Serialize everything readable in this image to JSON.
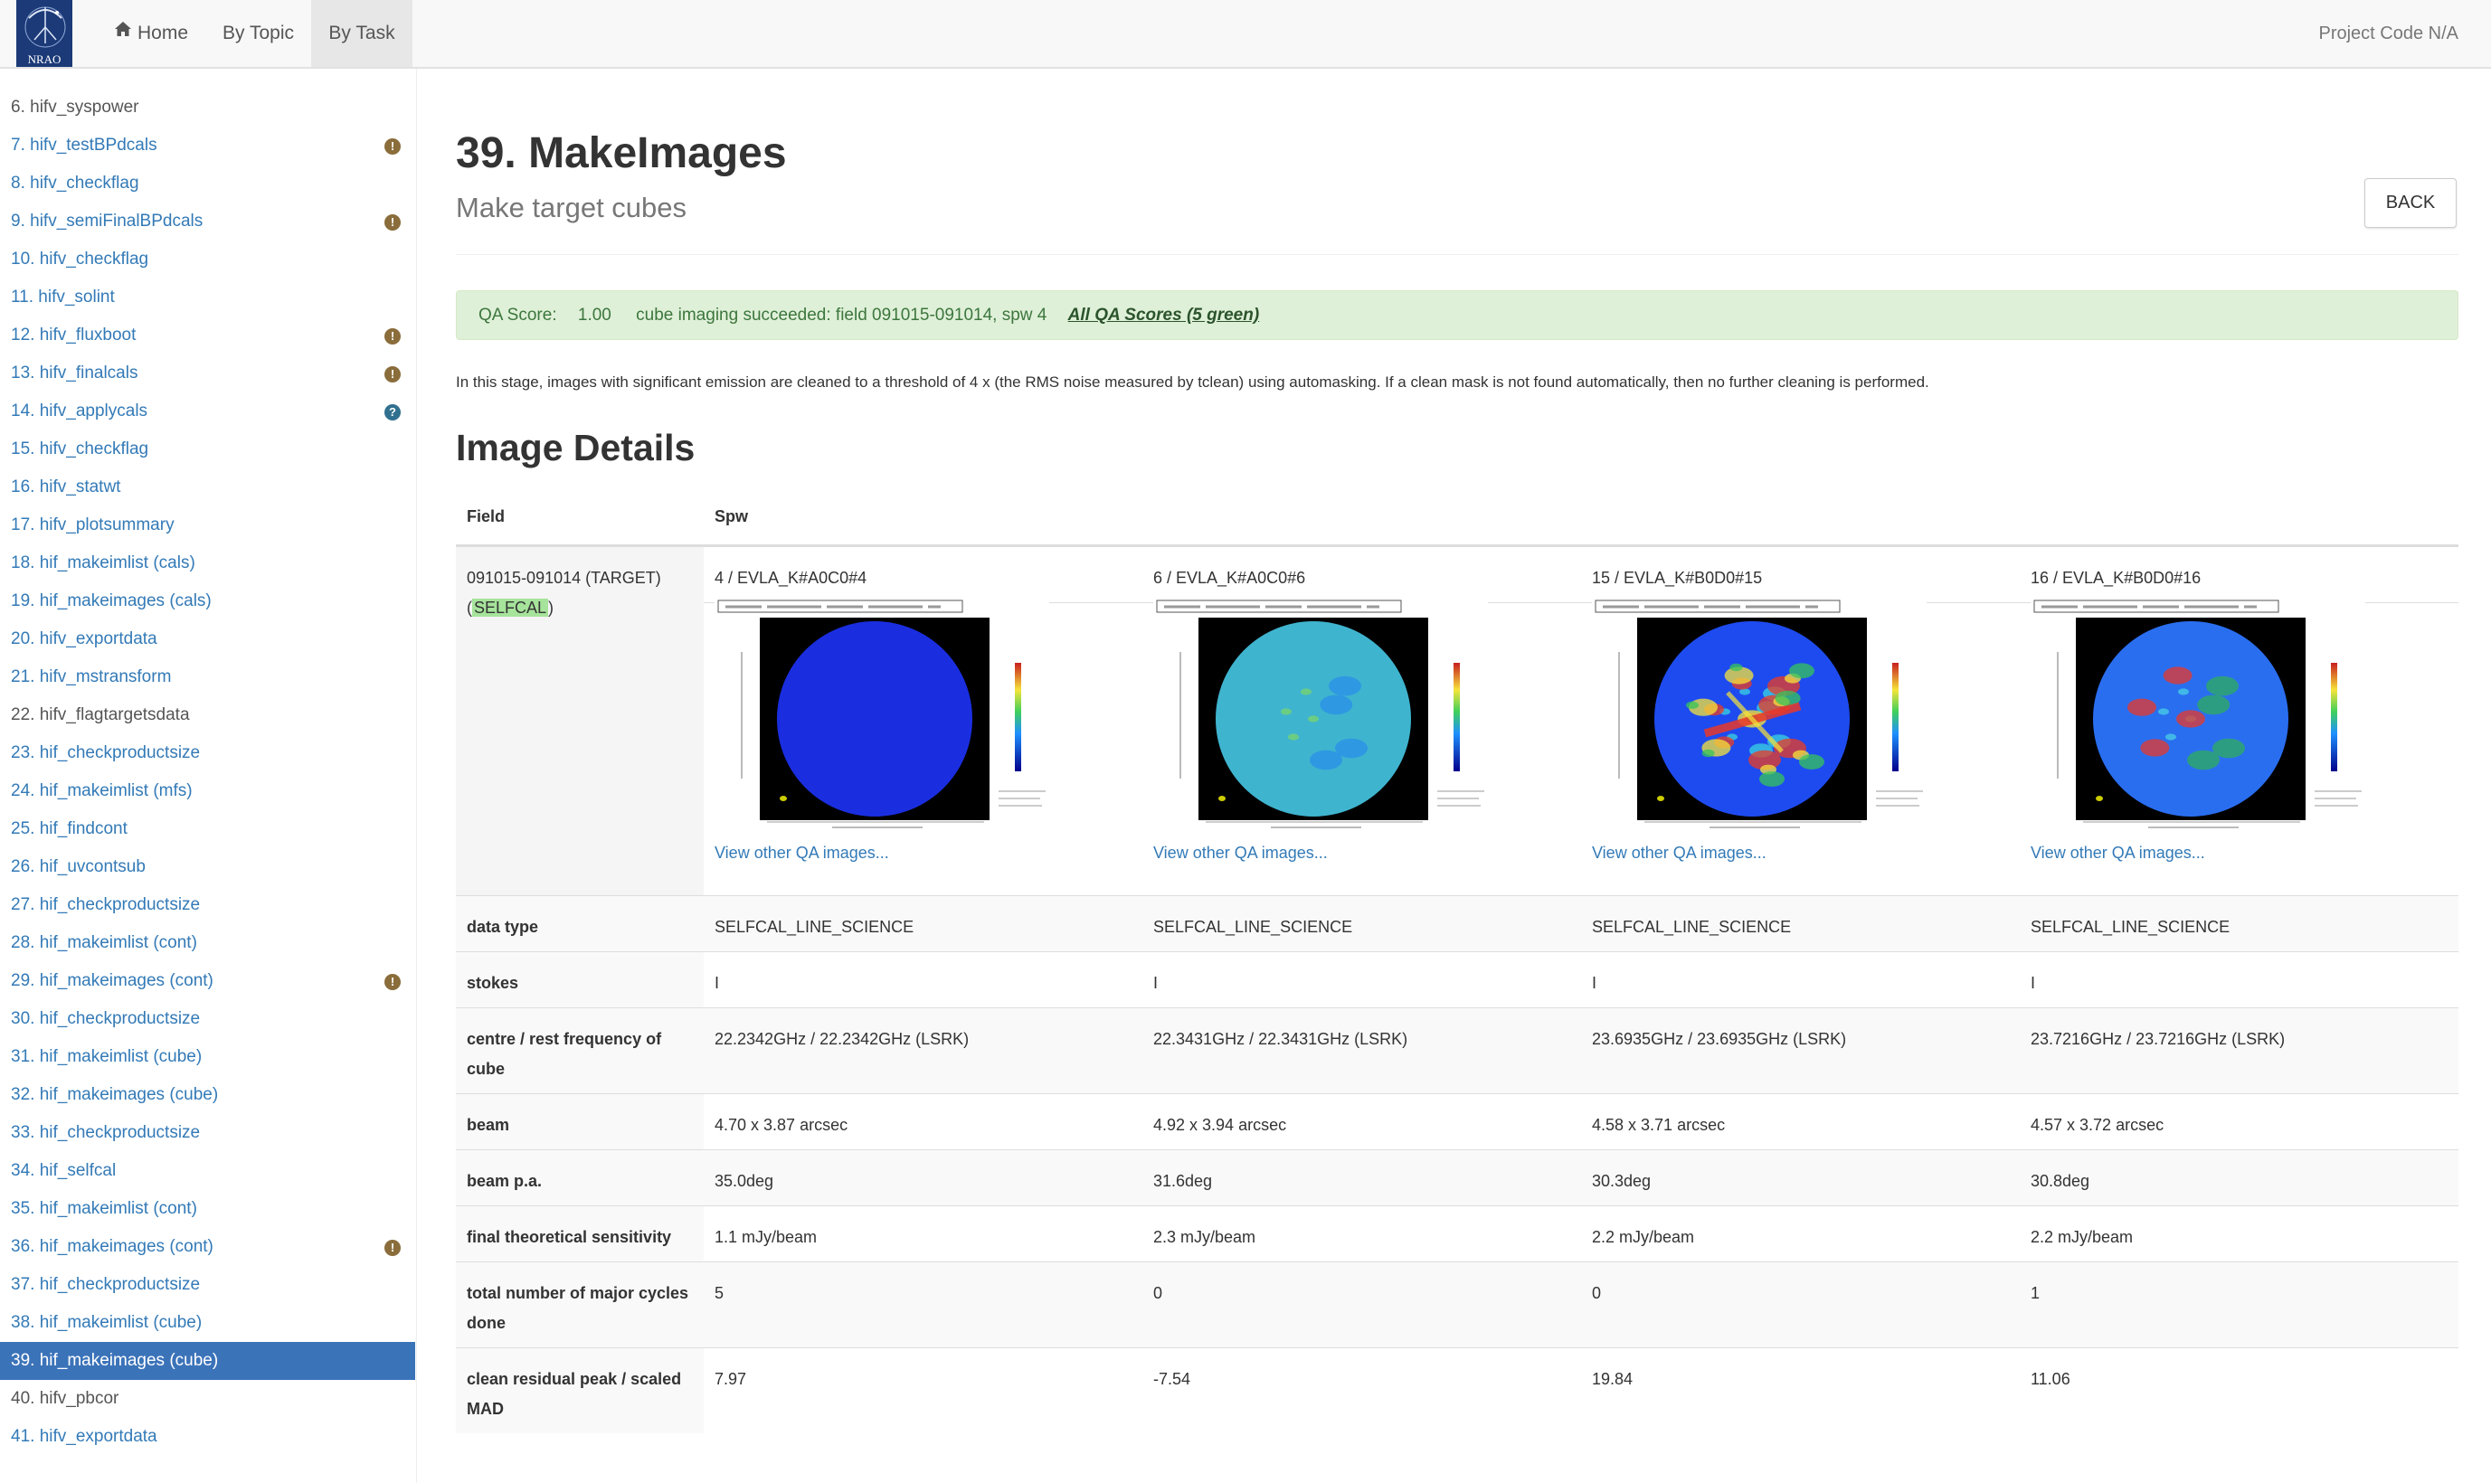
{
  "nav": {
    "logo_text": "NRAO",
    "home": "Home",
    "by_topic": "By Topic",
    "by_task": "By Task",
    "project_code": "Project Code N/A"
  },
  "sidebar": {
    "items": [
      {
        "label": "6. hifv_syspower",
        "style": "gray",
        "icon": ""
      },
      {
        "label": "7. hifv_testBPdcals",
        "style": "link",
        "icon": "warning"
      },
      {
        "label": "8. hifv_checkflag",
        "style": "link",
        "icon": ""
      },
      {
        "label": "9. hifv_semiFinalBPdcals",
        "style": "link",
        "icon": "warning"
      },
      {
        "label": "10. hifv_checkflag",
        "style": "link",
        "icon": ""
      },
      {
        "label": "11. hifv_solint",
        "style": "link",
        "icon": ""
      },
      {
        "label": "12. hifv_fluxboot",
        "style": "link",
        "icon": "warning"
      },
      {
        "label": "13. hifv_finalcals",
        "style": "link",
        "icon": "warning"
      },
      {
        "label": "14. hifv_applycals",
        "style": "link",
        "icon": "info"
      },
      {
        "label": "15. hifv_checkflag",
        "style": "link",
        "icon": ""
      },
      {
        "label": "16. hifv_statwt",
        "style": "link",
        "icon": ""
      },
      {
        "label": "17. hifv_plotsummary",
        "style": "link",
        "icon": ""
      },
      {
        "label": "18. hif_makeimlist (cals)",
        "style": "link",
        "icon": ""
      },
      {
        "label": "19. hif_makeimages (cals)",
        "style": "link",
        "icon": ""
      },
      {
        "label": "20. hifv_exportdata",
        "style": "link",
        "icon": ""
      },
      {
        "label": "21. hifv_mstransform",
        "style": "link",
        "icon": ""
      },
      {
        "label": "22. hifv_flagtargetsdata",
        "style": "gray",
        "icon": ""
      },
      {
        "label": "23. hif_checkproductsize",
        "style": "link",
        "icon": ""
      },
      {
        "label": "24. hif_makeimlist (mfs)",
        "style": "link",
        "icon": ""
      },
      {
        "label": "25. hif_findcont",
        "style": "link",
        "icon": ""
      },
      {
        "label": "26. hif_uvcontsub",
        "style": "link",
        "icon": ""
      },
      {
        "label": "27. hif_checkproductsize",
        "style": "link",
        "icon": ""
      },
      {
        "label": "28. hif_makeimlist (cont)",
        "style": "link",
        "icon": ""
      },
      {
        "label": "29. hif_makeimages (cont)",
        "style": "link",
        "icon": "warning"
      },
      {
        "label": "30. hif_checkproductsize",
        "style": "link",
        "icon": ""
      },
      {
        "label": "31. hif_makeimlist (cube)",
        "style": "link",
        "icon": ""
      },
      {
        "label": "32. hif_makeimages (cube)",
        "style": "link",
        "icon": ""
      },
      {
        "label": "33. hif_checkproductsize",
        "style": "link",
        "icon": ""
      },
      {
        "label": "34. hif_selfcal",
        "style": "link",
        "icon": ""
      },
      {
        "label": "35. hif_makeimlist (cont)",
        "style": "link",
        "icon": ""
      },
      {
        "label": "36. hif_makeimages (cont)",
        "style": "link",
        "icon": "warning"
      },
      {
        "label": "37. hif_checkproductsize",
        "style": "link",
        "icon": ""
      },
      {
        "label": "38. hif_makeimlist (cube)",
        "style": "link",
        "icon": ""
      },
      {
        "label": "39. hif_makeimages (cube)",
        "style": "active",
        "icon": ""
      },
      {
        "label": "40. hifv_pbcor",
        "style": "gray",
        "icon": ""
      },
      {
        "label": "41. hifv_exportdata",
        "style": "link",
        "icon": ""
      }
    ]
  },
  "page": {
    "title": "39. MakeImages",
    "subtitle": "Make target cubes",
    "back_label": "BACK",
    "qa": {
      "label": "QA Score:",
      "score": "1.00",
      "message": "cube imaging succeeded: field 091015-091014, spw 4",
      "link": "All QA Scores (5 green)",
      "color": "#dff0d8"
    },
    "description": "In this stage, images with significant emission are cleaned to a threshold of 4 x (the RMS noise measured by tclean) using automasking. If a clean mask is not found automatically, then no further cleaning is performed.",
    "section_title": "Image Details"
  },
  "table": {
    "header_field": "Field",
    "header_spw": "Spw",
    "field_name": "091015-091014 (TARGET)",
    "field_badge": "SELFCAL",
    "spws": [
      "4 / EVLA_K#A0C0#4",
      "6 / EVLA_K#A0C0#6",
      "15 / EVLA_K#B0D0#15",
      "16 / EVLA_K#B0D0#16"
    ],
    "qa_link": "View other QA images...",
    "rows": [
      {
        "label": "data type",
        "values": [
          "SELFCAL_LINE_SCIENCE",
          "SELFCAL_LINE_SCIENCE",
          "SELFCAL_LINE_SCIENCE",
          "SELFCAL_LINE_SCIENCE"
        ]
      },
      {
        "label": "stokes",
        "values": [
          "I",
          "I",
          "I",
          "I"
        ]
      },
      {
        "label": "centre / rest frequency of cube",
        "values": [
          "22.2342GHz / 22.2342GHz (LSRK)",
          "22.3431GHz / 22.3431GHz (LSRK)",
          "23.6935GHz / 23.6935GHz (LSRK)",
          "23.7216GHz / 23.7216GHz (LSRK)"
        ]
      },
      {
        "label": "beam",
        "values": [
          "4.70 x 3.87 arcsec",
          "4.92 x 3.94 arcsec",
          "4.58 x 3.71 arcsec",
          "4.57 x 3.72 arcsec"
        ]
      },
      {
        "label": "beam p.a.",
        "values": [
          "35.0deg",
          "31.6deg",
          "30.3deg",
          "30.8deg"
        ]
      },
      {
        "label": "final theoretical sensitivity",
        "values": [
          "1.1 mJy/beam",
          "2.3 mJy/beam",
          "2.2 mJy/beam",
          "2.2 mJy/beam"
        ]
      },
      {
        "label": "total number of major cycles done",
        "values": [
          "5",
          "0",
          "0",
          "1"
        ]
      },
      {
        "label": "clean residual peak / scaled MAD",
        "values": [
          "7.97",
          "-7.54",
          "19.84",
          "11.06"
        ]
      }
    ]
  },
  "colors": {
    "link": "#337ab7",
    "active_bg": "#3b73b9",
    "warning": "#8a6d3b",
    "info": "#31708f",
    "selfcal_highlight": "#a6e39b"
  }
}
